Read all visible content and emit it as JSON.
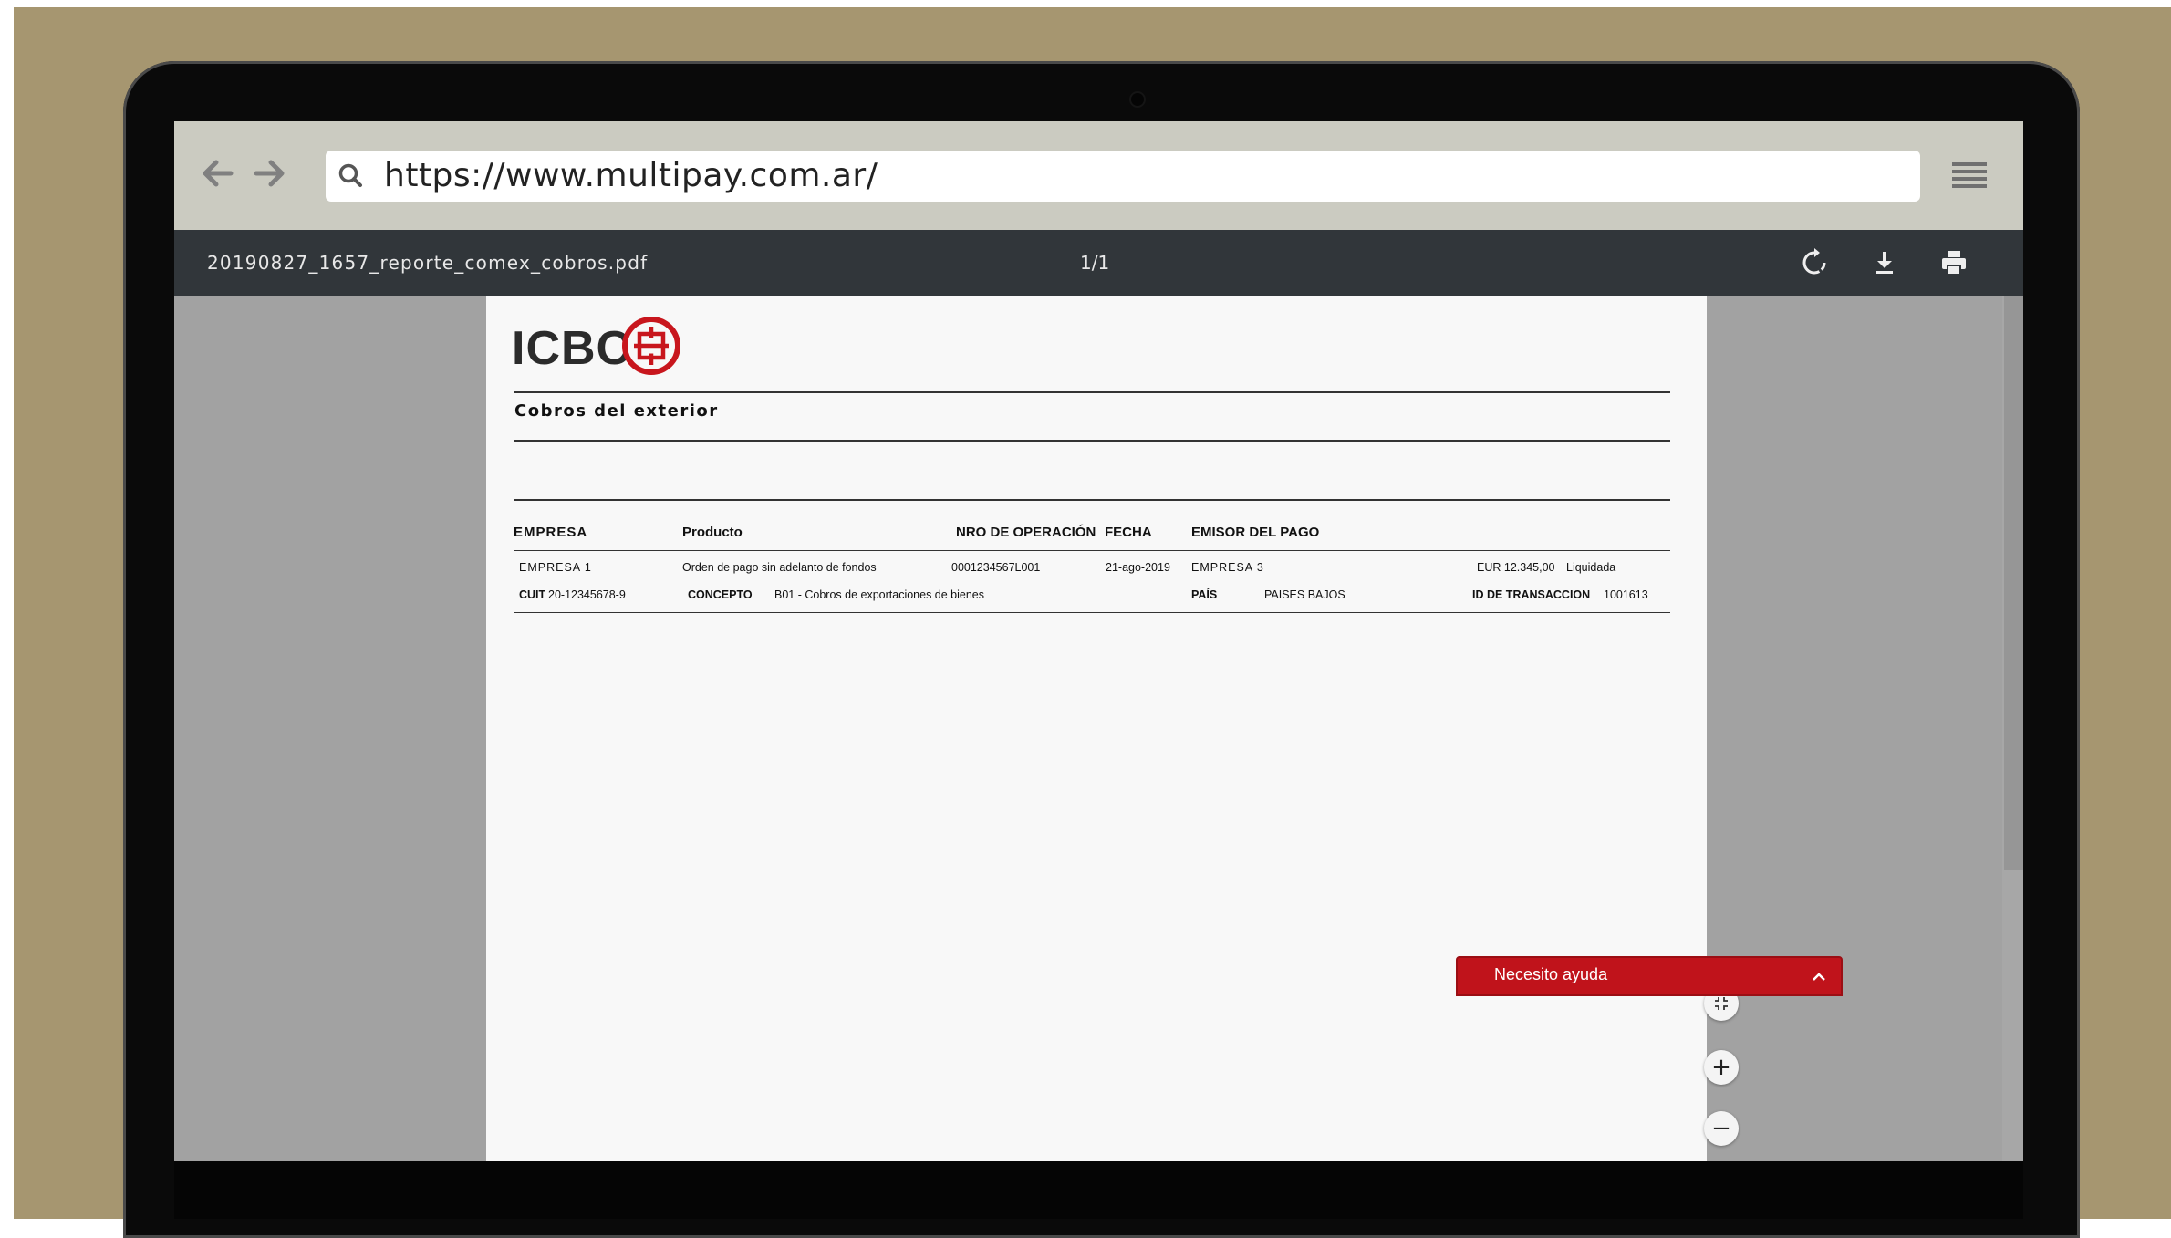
{
  "browser": {
    "url": "https://www.multipay.com.ar/",
    "icons": [
      "back-arrow-icon",
      "forward-arrow-icon",
      "search-icon",
      "hamburger-menu-icon"
    ]
  },
  "pdf_toolbar": {
    "filename": "20190827_1657_reporte_comex_cobros.pdf",
    "page_indicator": "1/1",
    "icons": [
      "rotate-icon",
      "download-icon",
      "print-icon"
    ]
  },
  "document": {
    "logo_text": "ICBC",
    "title": "Cobros del exterior",
    "headers": {
      "empresa": "EMPRESA",
      "producto": "Producto",
      "nro_operacion": "NRO DE OPERACIÓN",
      "fecha": "FECHA",
      "emisor": "EMISOR DEL PAGO"
    },
    "row": {
      "empresa": "EMPRESA 1",
      "producto": "Orden de pago sin adelanto de fondos",
      "nro_operacion": "0001234567L001",
      "fecha": "21-ago-2019",
      "emisor": "EMPRESA 3",
      "importe": "EUR 12.345,00",
      "estado": "Liquidada",
      "cuit_label": "CUIT",
      "cuit_value": "20-12345678-9",
      "concepto_label": "CONCEPTO",
      "concepto_value": "B01 - Cobros de exportaciones de bienes",
      "pais_label": "PAÍS",
      "pais_value": "PAISES BAJOS",
      "id_label": "ID DE TRANSACCION",
      "id_value": "1001613"
    }
  },
  "zoom": {
    "fit_icon": "fit-to-page-icon",
    "plus": "+",
    "minus": "−"
  },
  "help": {
    "label": "Necesito ayuda",
    "icon": "chevron-up-icon"
  },
  "colors": {
    "backdrop": "#a69670",
    "toolbar": "#31363a",
    "browser_bar": "#cbcbc1",
    "brand_red": "#c0131b"
  }
}
